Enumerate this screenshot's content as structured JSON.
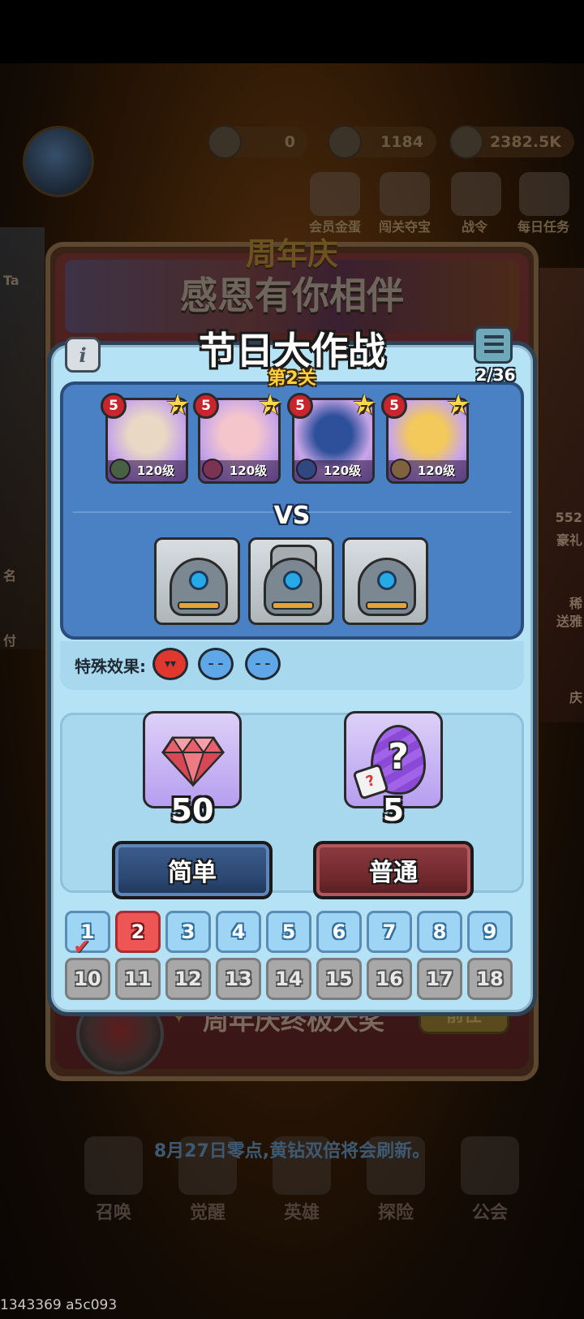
{
  "background": {
    "currencies": [
      "0",
      "1184",
      "2382.5K"
    ],
    "top_icons": [
      "会员金蛋",
      "闯关夺宝",
      "战令",
      "每日任务"
    ],
    "left_strip_text": [
      "Ta",
      "名",
      "付"
    ],
    "right_strip_text": [
      "552",
      "豪礼",
      "稀",
      "送雅",
      "庆"
    ],
    "anniversary_title": "周年庆",
    "anniversary_subtitle": "感恩有你相伴",
    "grand_prize_label": "周年庆终极大奖",
    "goto_label": "前往",
    "refresh_notice": "8月27日零点,黄钻双倍将会刷新。",
    "bottom_nav": [
      "召唤",
      "觉醒",
      "英雄",
      "探险",
      "公会"
    ]
  },
  "modal": {
    "title": "节日大作战",
    "subtitle": "第2关",
    "progress": "2/36",
    "heroes": [
      {
        "rank": "5",
        "stars": "7",
        "level": "120级",
        "color": "#6fbf4a",
        "skin": "#e8d8c4"
      },
      {
        "rank": "5",
        "stars": "7",
        "level": "120级",
        "color": "#e05a6a",
        "skin": "#f4c6cc"
      },
      {
        "rank": "5",
        "stars": "7",
        "level": "120级",
        "color": "#3a88d8",
        "skin": "#2e4f9a"
      },
      {
        "rank": "5",
        "stars": "7",
        "level": "120级",
        "color": "#e8c040",
        "skin": "#f2c95a"
      }
    ],
    "vs_label": "VS",
    "enemies": [
      "robot",
      "gear-robot",
      "robot"
    ],
    "effects_label": "特殊效果:",
    "effects": [
      "demon",
      "frown",
      "frown"
    ],
    "rewards": [
      {
        "kind": "gem",
        "count": "50"
      },
      {
        "kind": "mystery-egg",
        "count": "5"
      }
    ],
    "egg_mark": "?",
    "dice_mark": "?",
    "difficulty": {
      "easy": "简单",
      "normal": "普通"
    },
    "levels": {
      "row1": [
        "1",
        "2",
        "3",
        "4",
        "5",
        "6",
        "7",
        "8",
        "9"
      ],
      "row2": [
        "10",
        "11",
        "12",
        "13",
        "14",
        "15",
        "16",
        "17",
        "18"
      ],
      "completed": [
        "1"
      ],
      "current": "2"
    }
  },
  "footer_id": "1343369 a5c093",
  "colors": {
    "modal_bg": "#b6e2f5",
    "battle_panel": "#4a80c4",
    "current_level": "#ee5656",
    "locked_level": "#a8a8a8",
    "title_yellow": "#ffd23c"
  }
}
